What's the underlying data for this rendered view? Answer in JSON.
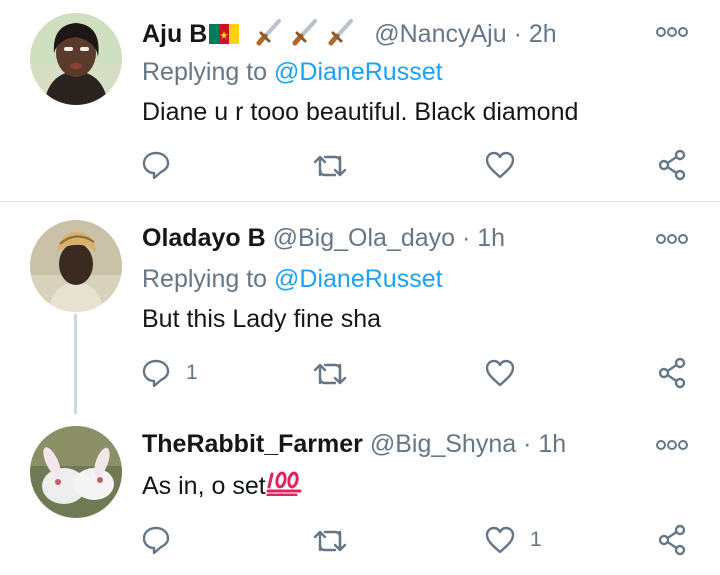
{
  "tweets": [
    {
      "name": "Aju B",
      "handle": "@NancyAju",
      "separator": "·",
      "time": "2h",
      "reply_prefix": "Replying to",
      "reply_mention": "@DianeRusset",
      "text": "Diane u r tooo beautiful. Black diamond",
      "reply_count": "",
      "like_count": "",
      "name_icons": [
        "cameroon-flag-icon",
        "dagger-icon",
        "dagger-icon",
        "dagger-icon"
      ]
    },
    {
      "name": "Oladayo B",
      "handle": "@Big_Ola_dayo",
      "separator": "·",
      "time": "1h",
      "reply_prefix": "Replying to",
      "reply_mention": "@DianeRusset",
      "text": "But this Lady fine sha",
      "reply_count": "1",
      "like_count": ""
    },
    {
      "name": "TheRabbit_Farmer",
      "handle": "@Big_Shyna",
      "separator": "·",
      "time": "1h",
      "text": "As in, o set",
      "text_icon": "hundred-points-icon",
      "reply_count": "",
      "like_count": "1"
    }
  ],
  "icons": {
    "reply": "reply-icon",
    "retweet": "retweet-icon",
    "like": "heart-icon",
    "share": "share-icon",
    "more": "more-icon"
  },
  "colors": {
    "text": "#14171a",
    "secondary": "#657786",
    "link": "#1da1f2",
    "divider": "#e1e8ed",
    "hundred_red": "#e0245e"
  }
}
